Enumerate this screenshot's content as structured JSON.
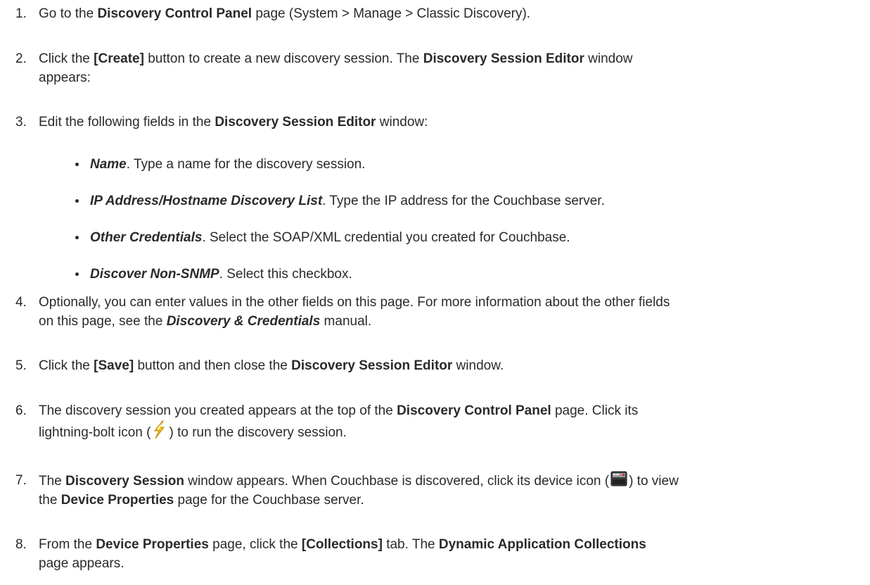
{
  "steps": [
    {
      "num": "1.",
      "parts": [
        {
          "t": "Go to the "
        },
        {
          "t": "Discovery Control Panel",
          "b": 1
        },
        {
          "t": " page (System > Manage > Classic Discovery)."
        }
      ]
    },
    {
      "num": "2.",
      "parts": [
        {
          "t": "Click the "
        },
        {
          "t": "[Create]",
          "b": 1
        },
        {
          "t": " button to create a new discovery session. The "
        },
        {
          "t": "Discovery Session Editor",
          "b": 1
        },
        {
          "t": " window"
        },
        {
          "br": 1
        },
        {
          "t": "appears:"
        }
      ]
    },
    {
      "num": "3.",
      "parts": [
        {
          "t": "Edit the following fields in the "
        },
        {
          "t": "Discovery Session Editor",
          "b": 1
        },
        {
          "t": " window:"
        }
      ]
    },
    {
      "num": "4.",
      "parts": [
        {
          "t": "Optionally, you can enter values in the other fields on this page. For more information about the other fields"
        },
        {
          "br": 1
        },
        {
          "t": "on this page, see the "
        },
        {
          "t": "Discovery & Credentials",
          "i": 1
        },
        {
          "t": " manual."
        }
      ]
    },
    {
      "num": "5.",
      "parts": [
        {
          "t": "Click the "
        },
        {
          "t": "[Save]",
          "b": 1
        },
        {
          "t": " button and then close the "
        },
        {
          "t": "Discovery Session Editor",
          "b": 1
        },
        {
          "t": " window."
        }
      ]
    },
    {
      "num": "6.",
      "parts": [
        {
          "t": "The discovery session you created appears at the top of the "
        },
        {
          "t": "Discovery Control Panel",
          "b": 1
        },
        {
          "t": " page. Click its"
        },
        {
          "br": 1
        },
        {
          "t": "lightning-bolt icon ("
        },
        {
          "icon": "lightning-bolt-icon"
        },
        {
          "t": ") to run the discovery session."
        }
      ]
    },
    {
      "num": "7.",
      "parts": [
        {
          "t": "The "
        },
        {
          "t": "Discovery Session",
          "b": 1
        },
        {
          "t": " window appears. When Couchbase is discovered, click its device icon ("
        },
        {
          "icon": "device-icon"
        },
        {
          "t": ") to view"
        },
        {
          "br": 1
        },
        {
          "t": "the "
        },
        {
          "t": "Device Properties",
          "b": 1
        },
        {
          "t": " page for the Couchbase server."
        }
      ]
    },
    {
      "num": "8.",
      "parts": [
        {
          "t": "From the "
        },
        {
          "t": "Device Properties",
          "b": 1
        },
        {
          "t": " page, click the "
        },
        {
          "t": "[Collections]",
          "b": 1
        },
        {
          "t": " tab. The "
        },
        {
          "t": "Dynamic Application Collections",
          "b": 1
        },
        {
          "br": 1
        },
        {
          "t": "page appears."
        }
      ]
    }
  ],
  "bullets": [
    {
      "label": "Name",
      "text": ". Type a name for the discovery session."
    },
    {
      "label": "IP Address/Hostname Discovery List",
      "text": ". Type the IP address for the Couchbase server."
    },
    {
      "label": "Other Credentials",
      "text": ". Select the SOAP/XML credential you created for Couchbase."
    },
    {
      "label": "Discover Non-SNMP",
      "text": ". Select this checkbox."
    }
  ]
}
